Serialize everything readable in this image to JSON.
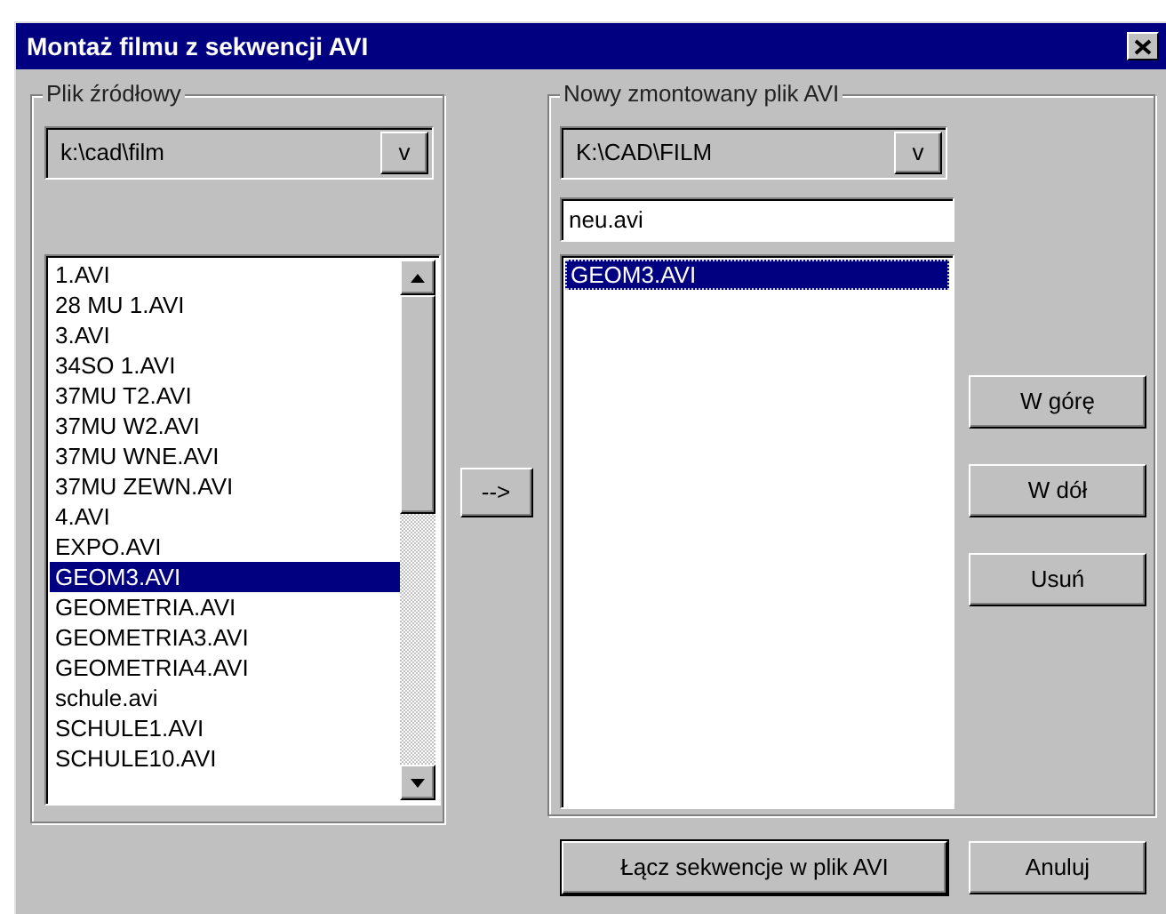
{
  "window": {
    "title": "Montaż filmu z sekwencji AVI"
  },
  "source": {
    "legend": "Plik źródłowy",
    "folder": "k:\\cad\\film",
    "dropdown_glyph": "v",
    "files": [
      {
        "name": "1.AVI",
        "selected": false
      },
      {
        "name": "28 MU 1.AVI",
        "selected": false
      },
      {
        "name": "3.AVI",
        "selected": false
      },
      {
        "name": "34SO 1.AVI",
        "selected": false
      },
      {
        "name": "37MU T2.AVI",
        "selected": false
      },
      {
        "name": "37MU W2.AVI",
        "selected": false
      },
      {
        "name": "37MU WNE.AVI",
        "selected": false
      },
      {
        "name": "37MU ZEWN.AVI",
        "selected": false
      },
      {
        "name": "4.AVI",
        "selected": false
      },
      {
        "name": "EXPO.AVI",
        "selected": false
      },
      {
        "name": "GEOM3.AVI",
        "selected": true
      },
      {
        "name": "GEOMETRIA.AVI",
        "selected": false
      },
      {
        "name": "GEOMETRIA3.AVI",
        "selected": false
      },
      {
        "name": "GEOMETRIA4.AVI",
        "selected": false
      },
      {
        "name": "schule.avi",
        "selected": false
      },
      {
        "name": "SCHULE1.AVI",
        "selected": false
      },
      {
        "name": "SCHULE10.AVI",
        "selected": false
      }
    ]
  },
  "move_button": "-->",
  "target": {
    "legend": "Nowy zmontowany plik AVI",
    "folder": "K:\\CAD\\FILM",
    "dropdown_glyph": "v",
    "file_name": "neu.avi",
    "files": [
      {
        "name": "GEOM3.AVI",
        "selected": true
      }
    ]
  },
  "side_buttons": [
    "W górę",
    "W dół",
    "Usuń"
  ],
  "footer_buttons": [
    {
      "label": "Łącz sekwencje w plik AVI",
      "default": true
    },
    {
      "label": "Anuluj",
      "default": false
    }
  ]
}
